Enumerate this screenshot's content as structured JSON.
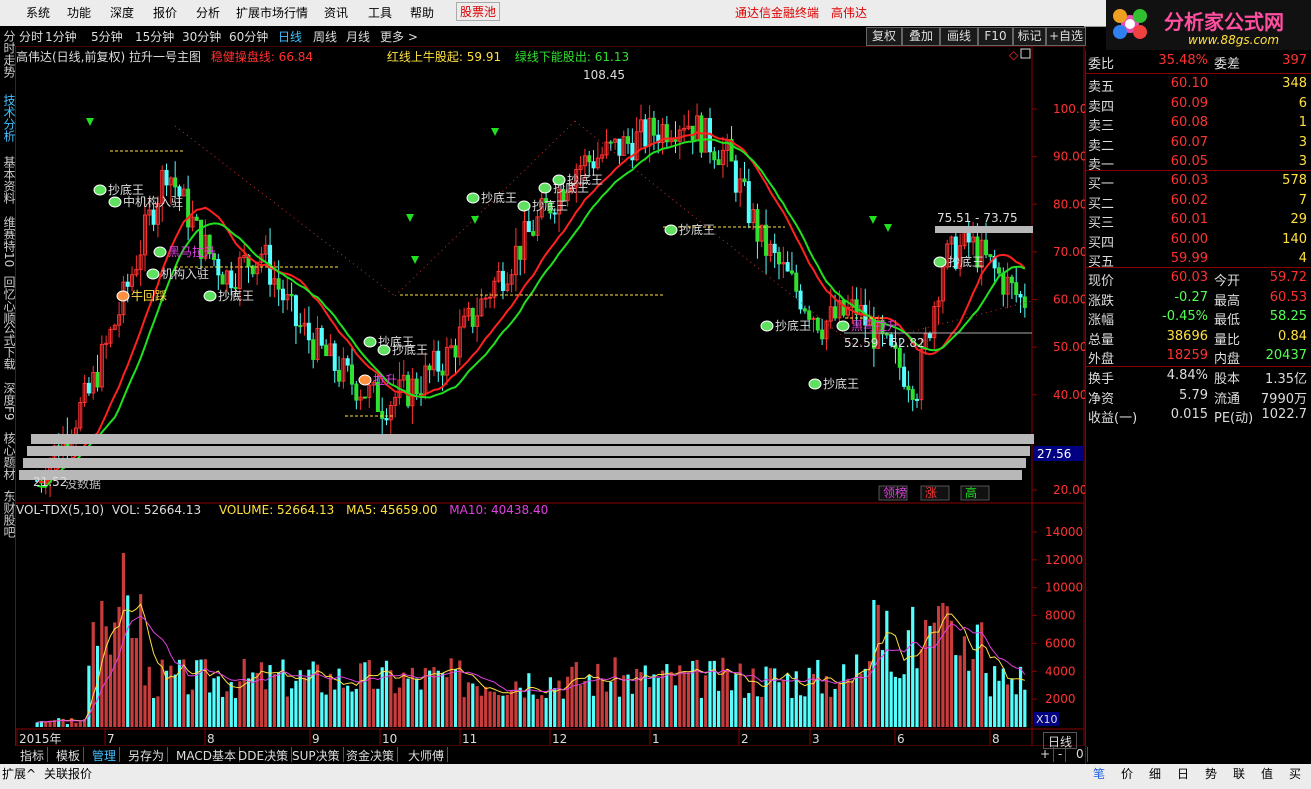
{
  "menu": {
    "items": [
      "系统",
      "功能",
      "深度",
      "报价",
      "分析",
      "扩展市场行情",
      "资讯",
      "工具",
      "帮助"
    ],
    "pool": "股票池",
    "terminal": "通达信金融终端",
    "stock_name": "高伟达"
  },
  "logo": {
    "title": "分析家公式网",
    "url": "www.88gs.com"
  },
  "left_tabs": [
    "分时走势",
    "技术分析",
    "基本资料",
    "维赛特10",
    "回忆心顺",
    "公式下载",
    "深度F9",
    "核心题材",
    "东财股吧"
  ],
  "periods": [
    "分时",
    "1分钟",
    "5分钟",
    "15分钟",
    "30分钟",
    "60分钟",
    "日线",
    "周线",
    "月线",
    "更多 >"
  ],
  "active_period": "日线",
  "toolbar_buttons": [
    "复权",
    "叠加",
    "画线",
    "F10",
    "标记",
    "+自选"
  ],
  "chart_title": {
    "name": "高伟达(日线,前复权) 拉升一号主图",
    "line1": "稳健操盘线: 66.84",
    "line2": "红线上牛股起: 59.91",
    "line3": "绿线下能股出: 61.13"
  },
  "price_axis": [
    "100.00",
    "90.00",
    "80.00",
    "70.00",
    "60.00",
    "50.00",
    "40.00",
    "27.56",
    "20.00"
  ],
  "annotations": {
    "high": "108.45",
    "range1": "75.51 - 73.75",
    "range2": "52.59 - 52.82",
    "low": "21.52",
    "no_data": "没数据"
  },
  "signal_labels": [
    "抄底王",
    "中机构入驻",
    "牛回踩",
    "黑马拉升",
    "机构入驻",
    "抄底王",
    "拉升",
    "抄底王",
    "抄底王",
    "抄底王",
    "抄底王",
    "抄底王",
    "抄底王",
    "抄底王",
    "抄底王",
    "抄底王",
    "黑马拉升",
    "抄底王"
  ],
  "legend_tags": [
    "领榜",
    "涨",
    "高"
  ],
  "volume_title": {
    "name": "VOL-TDX(5,10)",
    "vol": "VOL: 52664.13",
    "volume": "VOLUME: 52664.13",
    "ma5": "MA5: 45659.00",
    "ma10": "MA10: 40438.40"
  },
  "vol_axis": [
    "14000",
    "12000",
    "10000",
    "8000",
    "6000",
    "4000",
    "2000"
  ],
  "vol_unit": "X10",
  "time_axis": [
    "2015年",
    "7",
    "8",
    "9",
    "10",
    "11",
    "12",
    "1",
    "2",
    "3",
    "4",
    "5",
    "6",
    "7",
    "8"
  ],
  "bottom_tabs": [
    "指标",
    "模板",
    "管理",
    "另存为",
    "MACD基本",
    "DDE决策",
    "SUP决策",
    "资金决策",
    "大师傅"
  ],
  "bottom_right": {
    "period": "日线",
    "plus": "+",
    "minus": "-",
    "zero": "0"
  },
  "status_left": [
    "扩展^",
    "关联报价"
  ],
  "status_right": [
    "笔",
    "价",
    "细",
    "日",
    "势",
    "联",
    "值",
    "买"
  ],
  "quote": {
    "weibi": {
      "label": "委比",
      "value": "35.48%",
      "label2": "委差",
      "value2": "397"
    },
    "asks": [
      {
        "label": "卖五",
        "price": "60.10",
        "vol": "348"
      },
      {
        "label": "卖四",
        "price": "60.09",
        "vol": "6"
      },
      {
        "label": "卖三",
        "price": "60.08",
        "vol": "1"
      },
      {
        "label": "卖二",
        "price": "60.07",
        "vol": "3"
      },
      {
        "label": "卖一",
        "price": "60.05",
        "vol": "3"
      }
    ],
    "bids": [
      {
        "label": "买一",
        "price": "60.03",
        "vol": "578"
      },
      {
        "label": "买二",
        "price": "60.02",
        "vol": "7"
      },
      {
        "label": "买三",
        "price": "60.01",
        "vol": "29"
      },
      {
        "label": "买四",
        "price": "60.00",
        "vol": "140"
      },
      {
        "label": "买五",
        "price": "59.99",
        "vol": "4"
      }
    ],
    "stats": [
      {
        "l1": "现价",
        "v1": "60.03",
        "l2": "今开",
        "v2": "59.72"
      },
      {
        "l1": "涨跌",
        "v1": "-0.27",
        "l2": "最高",
        "v2": "60.53"
      },
      {
        "l1": "涨幅",
        "v1": "-0.45%",
        "l2": "最低",
        "v2": "58.25"
      },
      {
        "l1": "总量",
        "v1": "38696",
        "l2": "量比",
        "v2": "0.84"
      },
      {
        "l1": "外盘",
        "v1": "18259",
        "l2": "内盘",
        "v2": "20437"
      }
    ],
    "stats2": [
      {
        "l1": "换手",
        "v1": "4.84%",
        "l2": "股本",
        "v2": "1.35亿"
      },
      {
        "l1": "净资",
        "v1": "5.79",
        "l2": "流通",
        "v2": "7990万"
      },
      {
        "l1": "收益(一)",
        "v1": "0.015",
        "l2": "PE(动)",
        "v2": "1022.7"
      }
    ]
  },
  "colors": {
    "up": "#ff3232",
    "down": "#54ffff",
    "ma_red": "#ff2020",
    "ma_green": "#20e020",
    "grid": "#8b0000",
    "vol_up": "#c83c3c",
    "vol_down": "#54ffff"
  }
}
